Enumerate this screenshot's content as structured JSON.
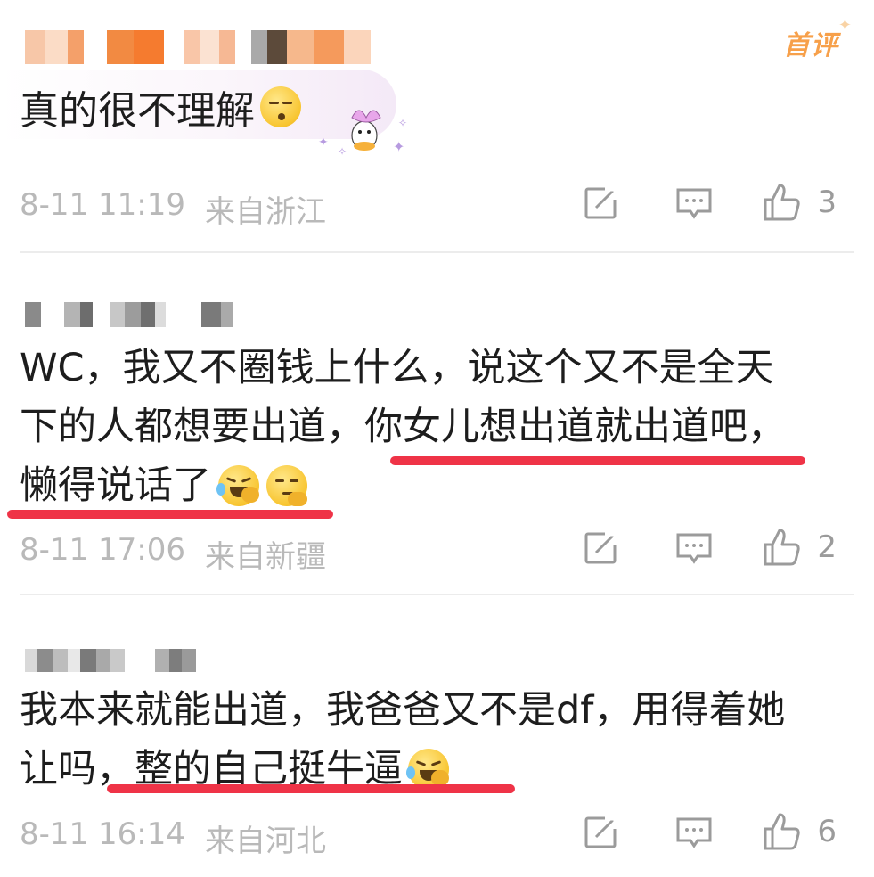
{
  "badge": {
    "label": "首评"
  },
  "comments": [
    {
      "text": "真的很不理解",
      "time": "8-11 11:19",
      "location": "来自浙江",
      "likes": "3"
    },
    {
      "lines": [
        "WC，我又不圈钱上什么，说这个又不是全天",
        "下的人都想要出道，你女儿想出道就出道吧，",
        "懒得说话了"
      ],
      "highlighted": [
        "你女儿想出道就出道吧，",
        "懒得说话了"
      ],
      "time": "8-11 17:06",
      "location": "来自新疆",
      "likes": "2"
    },
    {
      "lines": [
        "我本来就能出道，我爸爸又不是df，用得着她",
        "让吗，整的自己挺牛逼"
      ],
      "highlighted": [
        "整的自己挺牛逼"
      ],
      "time": "8-11 16:14",
      "location": "来自河北",
      "likes": "6"
    }
  ],
  "icons": {
    "share": "repost-icon",
    "comment": "comment-icon",
    "like": "thumbs-up-icon"
  },
  "colors": {
    "accent": "#ef3347",
    "badge": "#f7a04a",
    "meta": "#b9b9b9"
  }
}
